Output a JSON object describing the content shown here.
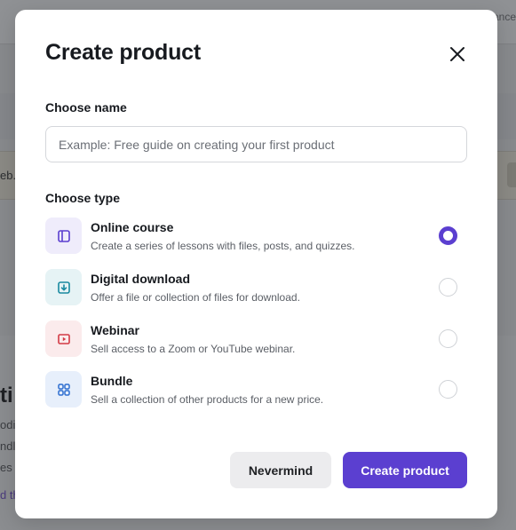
{
  "background": {
    "topbar_text": "ance",
    "row_text": "eb.f",
    "heading": "ti",
    "lines": [
      "odia",
      "ndl",
      "es"
    ],
    "link": "d th"
  },
  "modal": {
    "title": "Create product",
    "close_icon": "close-icon",
    "name_section": {
      "label": "Choose name",
      "placeholder": "Example: Free guide on creating your first product",
      "value": ""
    },
    "type_section": {
      "label": "Choose type",
      "options": [
        {
          "title": "Online course",
          "description": "Create a series of lessons with files, posts, and quizzes.",
          "icon": "book-icon",
          "icon_bg": "#efecfb",
          "icon_color": "#5b3fd0",
          "selected": true
        },
        {
          "title": "Digital download",
          "description": "Offer a file or collection of files for download.",
          "icon": "download-icon",
          "icon_bg": "#e6f3f5",
          "icon_color": "#1a8aa0",
          "selected": false
        },
        {
          "title": "Webinar",
          "description": "Sell access to a Zoom or YouTube webinar.",
          "icon": "play-icon",
          "icon_bg": "#fbebec",
          "icon_color": "#d33a45",
          "selected": false
        },
        {
          "title": "Bundle",
          "description": "Sell a collection of other products for a new price.",
          "icon": "grid-icon",
          "icon_bg": "#e7effb",
          "icon_color": "#2f6fd0",
          "selected": false
        }
      ]
    },
    "actions": {
      "cancel_label": "Nevermind",
      "confirm_label": "Create product"
    }
  },
  "colors": {
    "accent": "#5b3fd0",
    "overlay": "#8c8c8c"
  }
}
